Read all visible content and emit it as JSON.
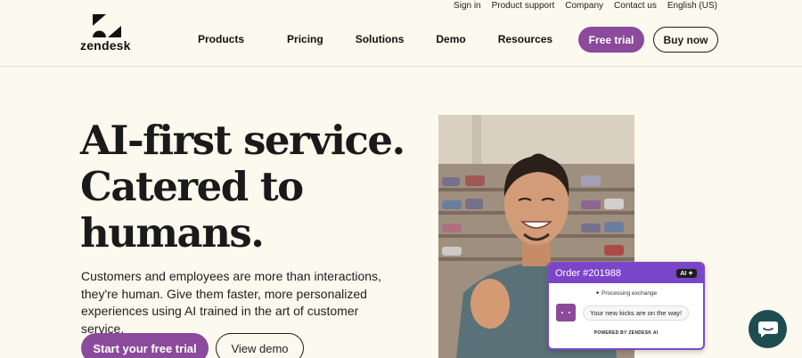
{
  "utility_nav": [
    "Sign in",
    "Product support",
    "Company",
    "Contact us",
    "English (US)"
  ],
  "brand": {
    "logo_text": "zendesk"
  },
  "main_nav": [
    "Products",
    "Pricing",
    "Solutions",
    "Demo",
    "Resources"
  ],
  "header_buttons": {
    "free_trial": "Free trial",
    "buy_now": "Buy now"
  },
  "hero": {
    "headline": [
      "AI-first service.",
      "Catered to",
      "humans."
    ],
    "subtext": "Customers and employees are more than interactions, they're human. Give them faster, more personalized experiences using AI trained in the art of customer service.",
    "primary_cta": "Start your free trial",
    "secondary_cta": "View demo"
  },
  "chat_card": {
    "order_title": "Order #201988",
    "ai_badge": "AI ✦",
    "processing_text": "✦ Processing exchange",
    "message": "Your new kicks are on the way!",
    "powered_by": "POWERED BY ZENDESK AI"
  },
  "colors": {
    "background": "#fcf9ef",
    "brand_purple": "#8b4a9b",
    "card_purple": "#7b45c9",
    "launcher_teal": "#1e4d51"
  },
  "icons": {
    "logo": "zendesk-z-logo",
    "chat_launcher": "chat-bubble-icon"
  }
}
